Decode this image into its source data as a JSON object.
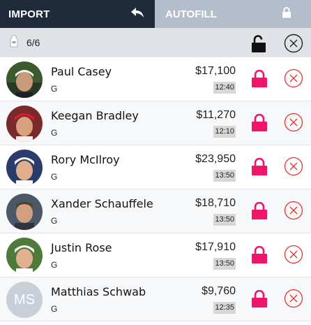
{
  "tabs": {
    "import_label": "IMPORT",
    "autofill_label": "AUTOFILL"
  },
  "lineup": {
    "count": "6/6"
  },
  "players": [
    {
      "name": "Paul Casey",
      "position": "G",
      "salary": "$17,100",
      "time": "12:40",
      "avatar": "photo"
    },
    {
      "name": "Keegan Bradley",
      "position": "G",
      "salary": "$11,270",
      "time": "12:10",
      "avatar": "photo"
    },
    {
      "name": "Rory McIlroy",
      "position": "G",
      "salary": "$23,950",
      "time": "13:50",
      "avatar": "photo"
    },
    {
      "name": "Xander Schauffele",
      "position": "G",
      "salary": "$18,710",
      "time": "13:50",
      "avatar": "photo"
    },
    {
      "name": "Justin Rose",
      "position": "G",
      "salary": "$17,910",
      "time": "13:50",
      "avatar": "photo"
    },
    {
      "name": "Matthias Schwab",
      "position": "G",
      "salary": "$9,760",
      "time": "12:35",
      "avatar": "MS"
    }
  ],
  "colors": {
    "import_bg": "#1f2b3a",
    "autofill_bg": "#b3bdcb",
    "lock_pink": "#f0146a",
    "remove_red": "#e8322e"
  }
}
